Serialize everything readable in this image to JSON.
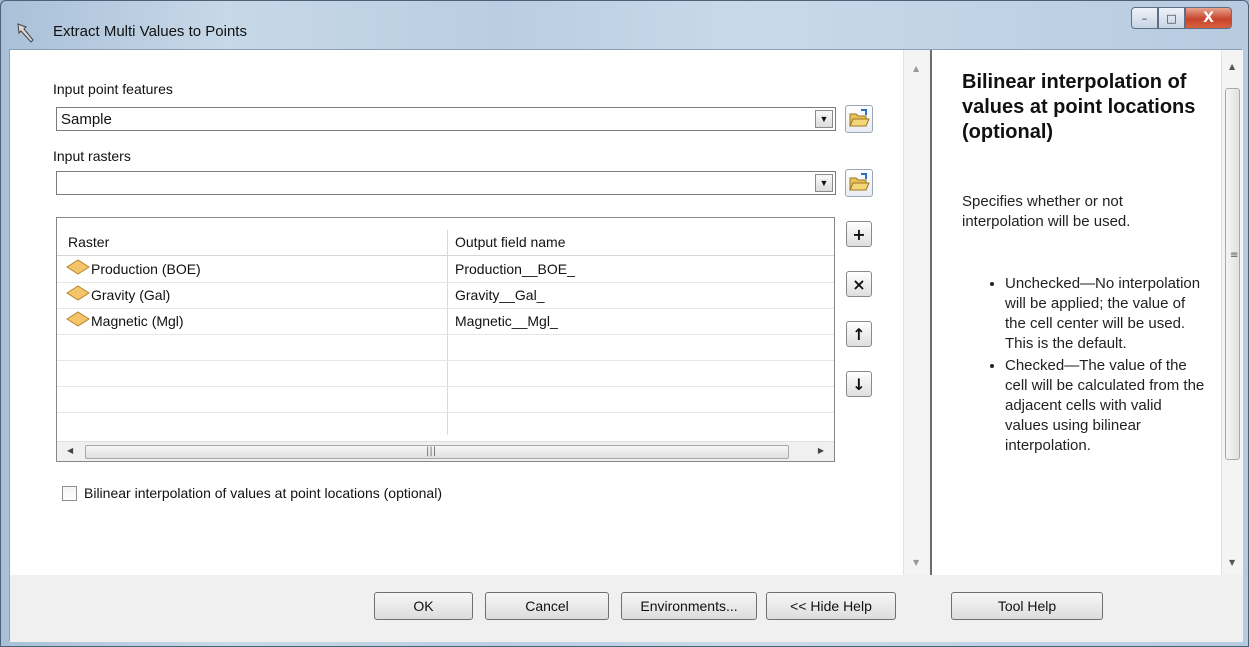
{
  "window": {
    "title": "Extract Multi Values to Points",
    "controls": {
      "minimize": "–",
      "maximize": "□",
      "close": "X"
    }
  },
  "form": {
    "input_point_features": {
      "label": "Input point features",
      "value": "Sample"
    },
    "input_rasters": {
      "label": "Input rasters",
      "value": ""
    },
    "table": {
      "columns": [
        "Raster",
        "Output field name"
      ],
      "rows": [
        {
          "raster": "Production (BOE)",
          "field": "Production__BOE_"
        },
        {
          "raster": "Gravity (Gal)",
          "field": "Gravity__Gal_"
        },
        {
          "raster": "Magnetic (Mgl)",
          "field": "Magnetic__Mgl_"
        }
      ]
    },
    "bilinear": {
      "label": "Bilinear interpolation of values at point locations (optional)",
      "checked": false
    },
    "side_buttons": {
      "add": "+",
      "remove": "×",
      "up": "↑",
      "down": "↓"
    }
  },
  "buttons": {
    "ok": "OK",
    "cancel": "Cancel",
    "environments": "Environments...",
    "hide_help": "<< Hide Help",
    "tool_help": "Tool Help"
  },
  "help": {
    "title": "Bilinear interpolation of values at point locations (optional)",
    "description": "Specifies whether or not interpolation will be used.",
    "items": [
      "Unchecked—No interpolation will be applied; the value of the cell center will be used. This is the default.",
      "Checked—The value of the cell will be calculated from the adjacent cells with valid values using bilinear interpolation."
    ]
  },
  "icons": {
    "title": "hammer-icon",
    "browse": "folder-open-icon",
    "raster": "raster-layer-icon"
  }
}
